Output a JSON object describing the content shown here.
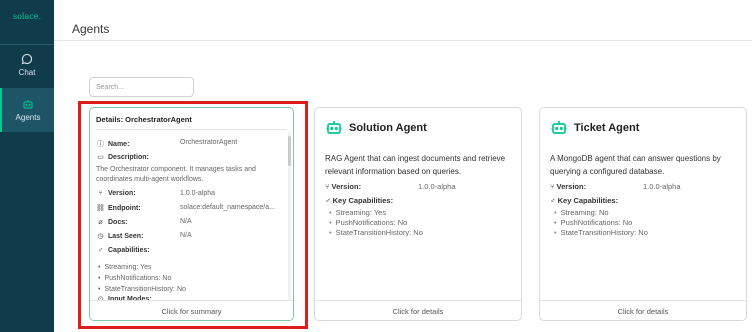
{
  "sidebar": {
    "brand": "solace.",
    "items": [
      {
        "label": "Chat",
        "icon": "chat-bubble-icon"
      },
      {
        "label": "Agents",
        "icon": "robot-icon"
      }
    ]
  },
  "header": {
    "title": "Agents"
  },
  "search": {
    "placeholder": "Search..."
  },
  "details": {
    "title": "Details: OrchestratorAgent",
    "name_label": "Name:",
    "name_value": "OrchestratorAgent",
    "description_label": "Description:",
    "description": "The Orchestrator component. It manages tasks and coordinates multi-agent workflows.",
    "version_label": "Version:",
    "version_value": "1.0.0-alpha",
    "endpoint_label": "Endpoint:",
    "endpoint_value": "solace:default_namespace/a...",
    "docs_label": "Docs:",
    "docs_value": "N/A",
    "lastseen_label": "Last Seen:",
    "lastseen_value": "N/A",
    "capabilities_label": "Capabilities:",
    "capabilities": [
      "Streaming: Yes",
      "PushNotifications: No",
      "StateTransitionHistory: No"
    ],
    "input_modes_label": "Input Modes:",
    "footer": "Click for summary"
  },
  "agents": [
    {
      "name": "Solution Agent",
      "description": "RAG Agent that can ingest documents and retrieve relevant information based on queries.",
      "version_label": "Version:",
      "version_value": "1.0.0-alpha",
      "capabilities_label": "Key Capabilities:",
      "capabilities": [
        "Streaming: Yes",
        "PushNotifications: No",
        "StateTransitionHistory: No"
      ],
      "footer": "Click for details"
    },
    {
      "name": "Ticket Agent",
      "description": "A MongoDB agent that can answer questions by querying a configured database.",
      "version_label": "Version:",
      "version_value": "1.0.0-alpha",
      "capabilities_label": "Key Capabilities:",
      "capabilities": [
        "Streaming: No",
        "PushNotifications: No",
        "StateTransitionHistory: No"
      ],
      "footer": "Click for details"
    }
  ],
  "colors": {
    "sidebar": "#0f3b4a",
    "accent": "#00c895",
    "highlight": "#e01b1b"
  }
}
